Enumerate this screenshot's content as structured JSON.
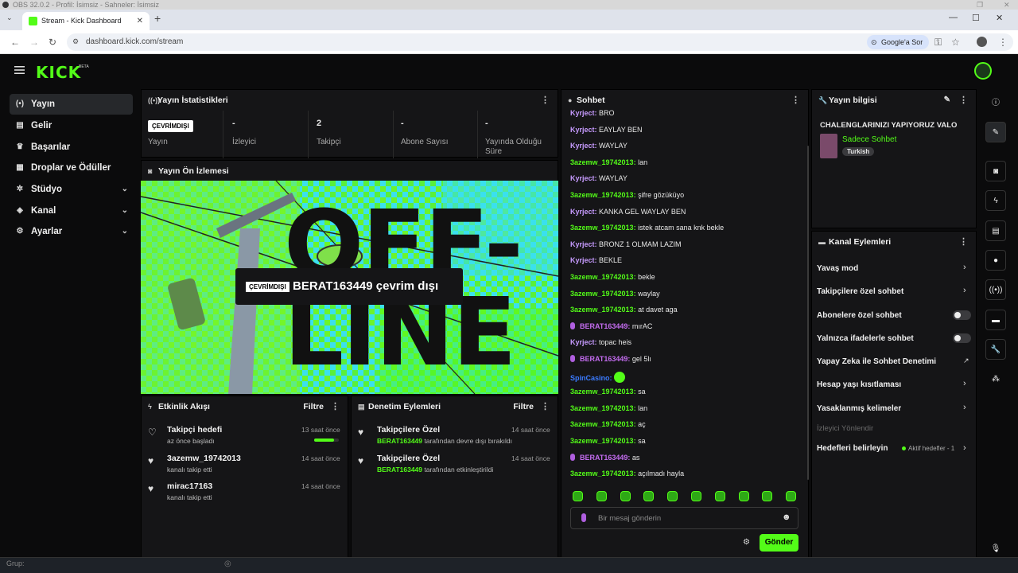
{
  "os": {
    "title": "OBS 32.0.2 - Profil: İsimsiz - Sahneler: İsimsiz"
  },
  "browser": {
    "tab_title": "Stream - Kick Dashboard",
    "url": "dashboard.kick.com/stream",
    "lens_label": "Google'a Sor"
  },
  "brand": {
    "logo": "KICK",
    "beta": "BETA",
    "accent": "#53fc18"
  },
  "sidebar": {
    "items": [
      {
        "label": "Yayın",
        "icon": "broadcast-icon",
        "active": true
      },
      {
        "label": "Gelir",
        "icon": "revenue-icon"
      },
      {
        "label": "Başarılar",
        "icon": "trophy-icon"
      },
      {
        "label": "Droplar ve Ödüller",
        "icon": "gift-icon"
      },
      {
        "label": "Stüdyo",
        "icon": "studio-icon",
        "expandable": true
      },
      {
        "label": "Kanal",
        "icon": "channel-icon",
        "expandable": true
      },
      {
        "label": "Ayarlar",
        "icon": "gear-icon",
        "expandable": true
      }
    ]
  },
  "stats": {
    "title": "Yayın İstatistikleri",
    "badge": "ÇEVRİMDIŞI",
    "cells": [
      {
        "value": "",
        "label": "Yayın"
      },
      {
        "value": "-",
        "label": "İzleyici"
      },
      {
        "value": "2",
        "label": "Takipçi"
      },
      {
        "value": "-",
        "label": "Abone Sayısı"
      },
      {
        "value": "-",
        "label": "Yayında Olduğu Süre"
      }
    ]
  },
  "preview": {
    "title": "Yayın Ön İzlemesi",
    "badge": "ÇEVRİMDIŞI",
    "offline_text": "BERAT163449 çevrim dışı",
    "banner_line1": "OFF-",
    "banner_line2": "LINE"
  },
  "activity": {
    "title": "Etkinlik Akışı",
    "filter": "Filtre",
    "items": [
      {
        "title": "Takipçi hedefi",
        "sub": "az önce başladı",
        "time": "13 saat önce",
        "progress": 0.8
      },
      {
        "title": "3azemw_19742013",
        "sub": "kanalı takip etti",
        "time": "14 saat önce"
      },
      {
        "title": "mirac17163",
        "sub": "kanalı takip etti",
        "time": "14 saat önce"
      }
    ]
  },
  "moderation": {
    "title": "Denetim Eylemleri",
    "filter": "Filtre",
    "items": [
      {
        "title": "Takipçilere Özel",
        "user": "BERAT163449",
        "rest": "tarafından devre dışı bırakıldı",
        "time": "14 saat önce"
      },
      {
        "title": "Takipçilere Özel",
        "user": "BERAT163449",
        "rest": "tarafından etkinleştirildi",
        "time": "14 saat önce"
      }
    ]
  },
  "chat": {
    "title": "Sohbet",
    "messages": [
      {
        "user": "Kyrject",
        "text": "BRO",
        "kind": "k"
      },
      {
        "user": "Kyrject",
        "text": "EAYLAY BEN",
        "kind": "k"
      },
      {
        "user": "Kyrject",
        "text": "WAYLAY",
        "kind": "k"
      },
      {
        "user": "3azemw_19742013",
        "text": "lan",
        "kind": "a"
      },
      {
        "user": "Kyrject",
        "text": "WAYLAY",
        "kind": "k"
      },
      {
        "user": "3azemw_19742013",
        "text": "şifre gözüküyo",
        "kind": "a"
      },
      {
        "user": "Kyrject",
        "text": "KANKA GEL WAYLAY BEN",
        "kind": "k"
      },
      {
        "user": "3azemw_19742013",
        "text": "istek atcam sana knk bekle",
        "kind": "a"
      },
      {
        "user": "Kyrject",
        "text": "BRONZ 1 OLMAM LAZIM",
        "kind": "k"
      },
      {
        "user": "Kyrject",
        "text": "BEKLE",
        "kind": "k"
      },
      {
        "user": "3azemw_19742013",
        "text": "bekle",
        "kind": "a"
      },
      {
        "user": "3azemw_19742013",
        "text": "waylay",
        "kind": "a"
      },
      {
        "user": "3azemw_19742013",
        "text": "at davet aga",
        "kind": "a"
      },
      {
        "user": "BERAT163449",
        "text": "mırAC",
        "kind": "b"
      },
      {
        "user": "Kyrject",
        "text": "topac heis",
        "kind": "k"
      },
      {
        "user": "BERAT163449",
        "text": "gel 5lı",
        "kind": "b"
      },
      {
        "user": "SpinCasino",
        "text": "",
        "kind": "s"
      },
      {
        "user": "3azemw_19742013",
        "text": "sa",
        "kind": "a"
      },
      {
        "user": "3azemw_19742013",
        "text": "lan",
        "kind": "a"
      },
      {
        "user": "3azemw_19742013",
        "text": "aç",
        "kind": "a"
      },
      {
        "user": "3azemw_19742013",
        "text": "sa",
        "kind": "a"
      },
      {
        "user": "BERAT163449",
        "text": "as",
        "kind": "b"
      },
      {
        "user": "3azemw_19742013",
        "text": "açılmadı hayla",
        "kind": "a"
      }
    ],
    "input_placeholder": "Bir mesaj gönderin",
    "send_label": "Gönder"
  },
  "stream_info": {
    "title": "Yayın bilgisi",
    "stream_title": "CHALENGLARINIZI YAPIYORUZ VALO",
    "category": "Sadece Sohbet",
    "language": "Turkish"
  },
  "channel_actions": {
    "title": "Kanal Eylemleri",
    "items": [
      {
        "label": "Yavaş mod",
        "control": "chevron"
      },
      {
        "label": "Takipçilere özel sohbet",
        "control": "chevron"
      },
      {
        "label": "Abonelere özel sohbet",
        "control": "toggle",
        "on": false
      },
      {
        "label": "Yalnızca ifadelerle sohbet",
        "control": "toggle",
        "on": false
      },
      {
        "label": "Yapay Zeka ile Sohbet Denetimi",
        "control": "external"
      },
      {
        "label": "Hesap yaşı kısıtlaması",
        "control": "chevron"
      },
      {
        "label": "Yasaklanmış kelimeler",
        "control": "chevron"
      }
    ],
    "section_label": "İzleyici Yönlendir",
    "goals_label": "Hedefleri belirleyin",
    "goals_status": "Aktif hedefler - 1"
  },
  "taskbar": {
    "label": "Grup:"
  }
}
